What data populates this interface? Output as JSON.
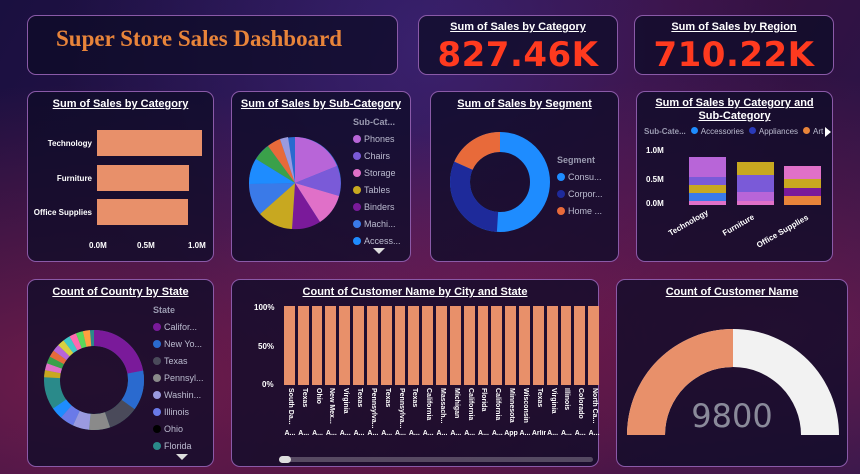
{
  "title": {
    "text": "Super Store Sales Dashboard"
  },
  "kpi_category": {
    "title": "Sum of Sales by Category",
    "value": "827.46K"
  },
  "kpi_region": {
    "title": "Sum of Sales by Region",
    "value": "710.22K"
  },
  "category_chart": {
    "title": "Sum of Sales by Category",
    "x_ticks": [
      "0.0M",
      "0.5M",
      "1.0M"
    ]
  },
  "subcat_chart": {
    "title": "Sum of Sales by Sub-Category",
    "legend_title": "Sub-Cat...",
    "legend": [
      "Phones",
      "Chairs",
      "Storage",
      "Tables",
      "Binders",
      "Machi...",
      "Access..."
    ],
    "colors": [
      "#b865d8",
      "#7a5ad8",
      "#e070c8",
      "#c8a820",
      "#7a1a9a",
      "#3a7ae8",
      "#1e8cff"
    ]
  },
  "segment_chart": {
    "title": "Sum of Sales by Segment",
    "legend_title": "Segment",
    "legend": [
      "Consu...",
      "Corpor...",
      "Home ..."
    ],
    "colors": [
      "#1e8cff",
      "#1e2a9a",
      "#e86a3a"
    ]
  },
  "cat_subcat_chart": {
    "title_line1": "Sum of Sales by Category and",
    "title_line2": "Sub-Category",
    "legend_title": "Sub-Cate...",
    "legend": [
      "Accessories",
      "Appliances",
      "Art"
    ],
    "colors": [
      "#1e8cff",
      "#2a3ab8",
      "#e8843a"
    ],
    "y_ticks": [
      "1.0M",
      "0.5M",
      "0.0M"
    ],
    "categories": [
      "Technology",
      "Furniture",
      "Office Supplies"
    ]
  },
  "state_chart": {
    "title": "Count of Country by State",
    "legend_title": "State",
    "legend": [
      "Califor...",
      "New Yo...",
      "Texas",
      "Pennsyl...",
      "Washin...",
      "Illinois",
      "Ohio",
      "Florida"
    ],
    "colors": [
      "#7a1a9a",
      "#2a6acf",
      "#4a4a5a",
      "#8a8a8a",
      "#9a9adf",
      "#6a7ae8",
      "#000000",
      "#2a8a8a"
    ]
  },
  "city_chart": {
    "title": "Count of Customer Name by City and State",
    "y_ticks": [
      "100%",
      "50%",
      "0%"
    ],
    "cities": [
      "South Da...",
      "Texas",
      "Ohio",
      "New Mex...",
      "Virginia",
      "Texas",
      "Pennsylva...",
      "Texas",
      "Pennsylva...",
      "Texas",
      "California",
      "Massach...",
      "Michigan",
      "California",
      "Florida",
      "California",
      "Minnesota",
      "Wisconsin",
      "Texas",
      "Virginia",
      "Illinois",
      "Colorado",
      "North Ca..."
    ],
    "states": [
      "A...",
      "A...",
      "A...",
      "A...",
      "A...",
      "A...",
      "A...",
      "A...",
      "A...",
      "A...",
      "A...",
      "A...",
      "A...",
      "A...",
      "A...",
      "A...",
      "Appl...",
      "A...",
      "Arlin...",
      "A...",
      "A...",
      "A...",
      "A..."
    ],
    "values": [
      100,
      100,
      100,
      100,
      100,
      100,
      100,
      100,
      100,
      100,
      100,
      100,
      100,
      100,
      100,
      100,
      100,
      100,
      100,
      100,
      100,
      100,
      100
    ]
  },
  "gauge": {
    "title": "Count of Customer Name",
    "value": "9800",
    "fill_fraction": 0.5
  },
  "chart_data": [
    {
      "type": "bar",
      "title": "Sum of Sales by Category",
      "categories": [
        "Technology",
        "Furniture",
        "Office Supplies"
      ],
      "values": [
        0.83,
        0.73,
        0.72
      ],
      "xlabel": "",
      "ylabel": "",
      "xlim": [
        0,
        1.0
      ]
    },
    {
      "type": "pie",
      "title": "Sum of Sales by Sub-Category",
      "categories": [
        "Phones",
        "Chairs",
        "Storage",
        "Tables",
        "Binders",
        "Machi...",
        "Access..."
      ],
      "values": [
        0.15,
        0.14,
        0.1,
        0.09,
        0.09,
        0.08,
        0.07
      ]
    },
    {
      "type": "pie",
      "title": "Sum of Sales by Segment",
      "categories": [
        "Consu...",
        "Corpor...",
        "Home ..."
      ],
      "values": [
        0.51,
        0.3,
        0.19
      ]
    },
    {
      "type": "bar",
      "title": "Sum of Sales by Category and Sub-Category",
      "categories": [
        "Technology",
        "Furniture",
        "Office Supplies"
      ],
      "values": [
        0.83,
        0.73,
        0.72
      ],
      "ylim": [
        0,
        1.0
      ]
    },
    {
      "type": "bar",
      "title": "Count of Customer Name by City and State",
      "values": [
        100,
        100,
        100,
        100,
        100,
        100,
        100,
        100,
        100,
        100,
        100,
        100,
        100,
        100,
        100,
        100,
        100,
        100,
        100,
        100,
        100,
        100,
        100
      ],
      "ylim": [
        0,
        100
      ]
    }
  ]
}
